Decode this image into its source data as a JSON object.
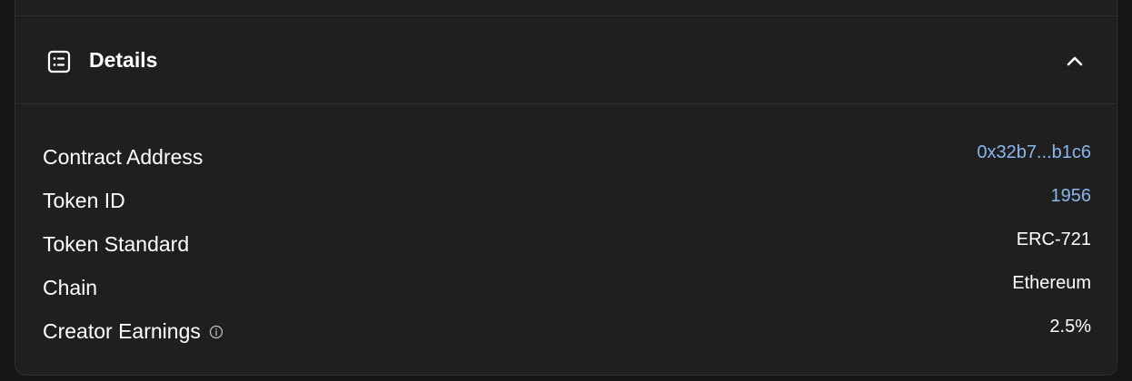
{
  "details": {
    "title": "Details",
    "header_icon": "list-details-icon",
    "toggle_icon": "chevron-up-icon",
    "rows": [
      {
        "label": "Contract Address",
        "value": "0x32b7...b1c6",
        "is_link": true
      },
      {
        "label": "Token ID",
        "value": "1956",
        "is_link": true
      },
      {
        "label": "Token Standard",
        "value": "ERC-721",
        "is_link": false
      },
      {
        "label": "Chain",
        "value": "Ethereum",
        "is_link": false
      },
      {
        "label": "Creator Earnings",
        "value": "2.5%",
        "is_link": false,
        "icon": "info-icon"
      }
    ]
  },
  "colors": {
    "page_background": "#161616",
    "panel_background": "#1f1f1f",
    "divider": "#2e2e2e",
    "text": "#ffffff",
    "link": "#8ab6ee"
  }
}
